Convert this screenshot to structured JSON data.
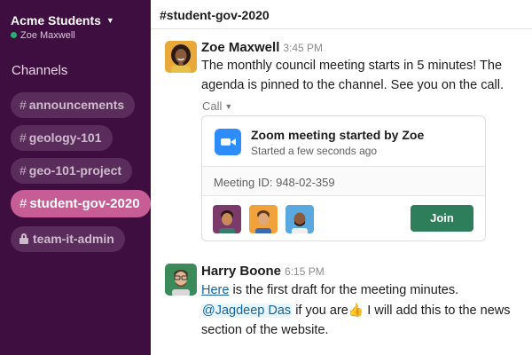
{
  "workspace": {
    "name": "Acme Students",
    "user": "Zoe Maxwell"
  },
  "sidebar": {
    "heading": "Channels",
    "channels": [
      {
        "name": "announcements",
        "prefix": "#"
      },
      {
        "name": "geology-101",
        "prefix": "#"
      },
      {
        "name": "geo-101-project",
        "prefix": "#"
      },
      {
        "name": "student-gov-2020",
        "prefix": "#",
        "active": true
      },
      {
        "name": "team-it-admin",
        "icon": "lock-icon"
      }
    ]
  },
  "header": {
    "channel": "#student-gov-2020"
  },
  "messages": [
    {
      "author": "Zoe Maxwell",
      "time": "3:45 PM",
      "text": "The monthly council meeting starts in 5 minutes! The agenda is pinned to the channel. See you on the call."
    },
    {
      "author": "Harry Boone",
      "time": "6:15 PM",
      "link_text": "Here",
      "text_after_link": " is the first draft for the meeting minutes.",
      "mention": "@Jagdeep Das",
      "text_after_mention": " if you are",
      "emoji": "👍",
      "text_after_emoji": " I will add this to the news section of the website."
    }
  ],
  "call": {
    "label": "Call",
    "title": "Zoom meeting started by Zoe",
    "subtitle": "Started a few seconds ago",
    "meeting_id": "Meeting ID: 948-02-359",
    "join_label": "Join"
  },
  "colors": {
    "sidebar_bg": "#3f0e40",
    "active_channel": "#c65d95",
    "join_button": "#2e7d5b",
    "zoom_blue": "#2d8cff",
    "link": "#1264a3"
  }
}
